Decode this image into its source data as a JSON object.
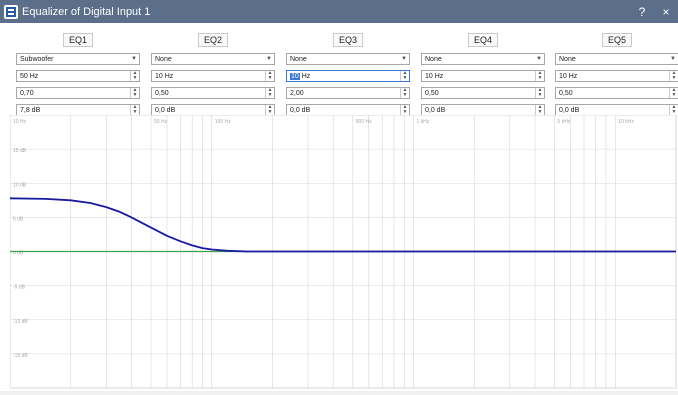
{
  "window": {
    "title": "Equalizer of Digital Input 1",
    "help_label": "?",
    "close_label": "×"
  },
  "eq": [
    {
      "label": "EQ1",
      "type": "Subwoofer",
      "freq": "50 Hz",
      "q": "0,70",
      "gain": "7,8 dB"
    },
    {
      "label": "EQ2",
      "type": "None",
      "freq": "10 Hz",
      "q": "0,50",
      "gain": "0,0 dB"
    },
    {
      "label": "EQ3",
      "type": "None",
      "freq_sel": "10",
      "freq_rest": " Hz",
      "q": "2,00",
      "gain": "0,0 dB"
    },
    {
      "label": "EQ4",
      "type": "None",
      "freq": "10 Hz",
      "q": "0,50",
      "gain": "0,0 dB"
    },
    {
      "label": "EQ5",
      "type": "None",
      "freq": "10 Hz",
      "q": "0,50",
      "gain": "0,0 dB"
    }
  ],
  "chart_data": {
    "type": "line",
    "x_scale": "log",
    "xlim": [
      10,
      20000
    ],
    "ylim": [
      -20,
      20
    ],
    "x_tick_labels": [
      "10 Hz",
      "50 Hz",
      "100 Hz",
      "500 Hz",
      "1 kHz",
      "5 kHz",
      "10 kHz",
      "20 kHz"
    ],
    "x_ticks": [
      10,
      50,
      100,
      500,
      1000,
      5000,
      10000,
      20000
    ],
    "y_tick_labels": [
      "15 dB",
      "10 dB",
      "5 dB",
      "0 dB",
      "-5 dB",
      "-10 dB",
      "-15 dB"
    ],
    "y_ticks": [
      15,
      10,
      5,
      0,
      -5,
      -10,
      -15
    ],
    "grid": true,
    "series": [
      {
        "x": [
          10,
          15,
          20,
          25,
          30,
          35,
          40,
          45,
          50,
          60,
          70,
          80,
          90,
          100,
          120,
          150,
          200,
          300,
          1000,
          20000
        ],
        "y": [
          7.8,
          7.7,
          7.5,
          7.1,
          6.5,
          5.8,
          5.0,
          4.2,
          3.5,
          2.3,
          1.5,
          0.9,
          0.5,
          0.3,
          0.1,
          0.0,
          0.0,
          0.0,
          0.0,
          0.0
        ],
        "color": "#1a1aa0"
      },
      {
        "x": [
          10,
          20000
        ],
        "y": [
          0,
          0
        ],
        "color": "#3aa04a"
      }
    ]
  }
}
